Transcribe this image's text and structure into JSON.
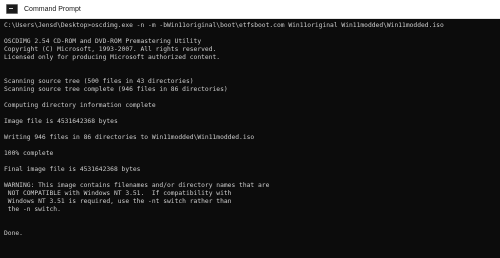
{
  "window": {
    "title": "Command Prompt",
    "icon": "command-prompt-icon"
  },
  "console": {
    "lines": [
      "C:\\Users\\Jensd\\Desktop>oscdimg.exe -n -m -bWin11original\\boot\\etfsboot.com Win11original Win11modded\\Win11modded.iso",
      "",
      "OSCDIMG 2.54 CD-ROM and DVD-ROM Premastering Utility",
      "Copyright (C) Microsoft, 1993-2007. All rights reserved.",
      "Licensed only for producing Microsoft authorized content.",
      "",
      "",
      "Scanning source tree (500 files in 43 directories)",
      "Scanning source tree complete (946 files in 86 directories)",
      "",
      "Computing directory information complete",
      "",
      "Image file is 4531642368 bytes",
      "",
      "Writing 946 files in 86 directories to Win11modded\\Win11modded.iso",
      "",
      "100% complete",
      "",
      "Final image file is 4531642368 bytes",
      "",
      "WARNING: This image contains filenames and/or directory names that are",
      " NOT COMPATIBLE with Windows NT 3.51.  If compatibility with",
      " Windows NT 3.51 is required, use the -nt switch rather than",
      " the -n switch.",
      "",
      "",
      "Done."
    ]
  }
}
